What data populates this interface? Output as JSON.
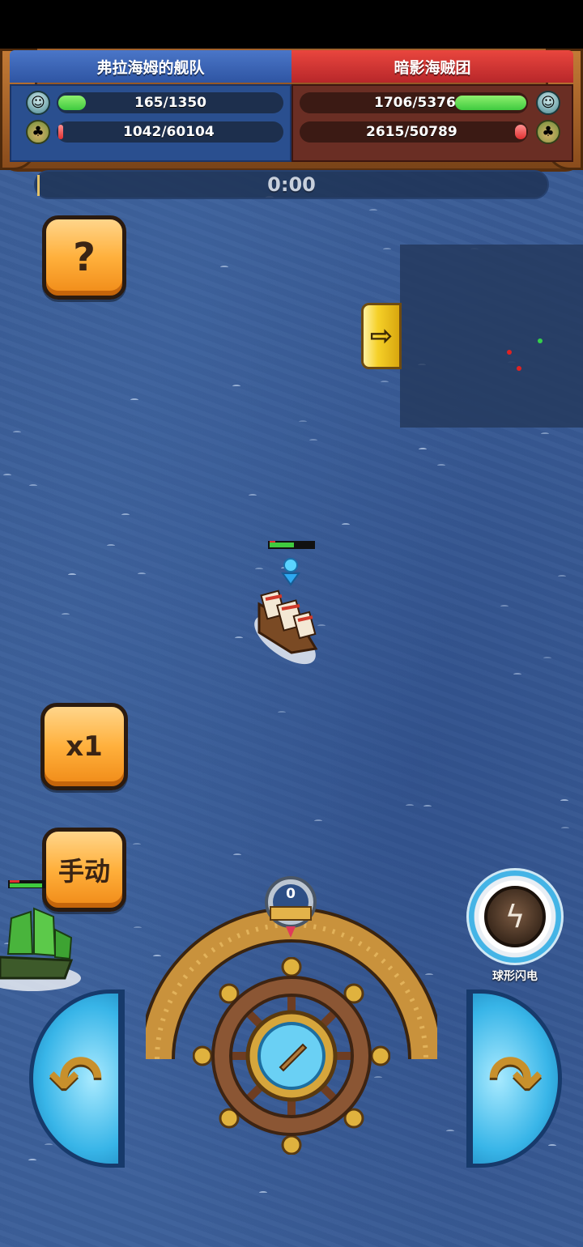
{
  "status_bar": {},
  "teams": {
    "left": {
      "name": "弗拉海姆的舰队",
      "crew": {
        "value": "165/1350",
        "fraction": 0.122
      },
      "hull": {
        "value": "1042/60104",
        "fraction": 0.017
      },
      "color": "#2f55a3"
    },
    "right": {
      "name": "暗影海贼团",
      "crew": {
        "value": "1706/5376",
        "fraction": 0.317
      },
      "hull": {
        "value": "2615/50789",
        "fraction": 0.051
      },
      "color": "#b8272a"
    }
  },
  "timer": {
    "text": "0:00"
  },
  "buttons": {
    "help": "?",
    "speed": "x1",
    "manual": "手动",
    "minimap_toggle": "⇨"
  },
  "steering": {
    "angle": "0"
  },
  "skill": {
    "label": "球形闪电",
    "icon": "lightning-orb-icon"
  },
  "colors": {
    "sea": "#3a5c96",
    "hp_green": "#3fca3f",
    "hp_red": "#e03030",
    "button_orange": "#ffb03c"
  }
}
